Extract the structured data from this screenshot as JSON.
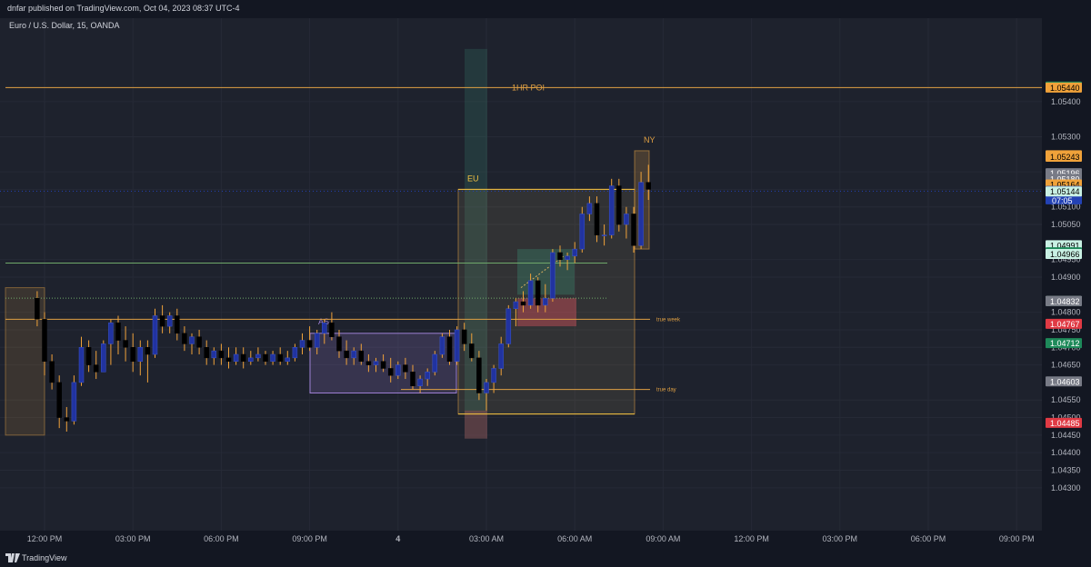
{
  "header": {
    "published": "dnfar published on TradingView.com, Oct 04, 2023 08:37 UTC-4"
  },
  "symbol": "Euro / U.S. Dollar, 15, OANDA",
  "footer": {
    "brand": "TradingView"
  },
  "colors": {
    "background": "#1e222d",
    "grid": "#262a36",
    "bull_body": "#2133a0",
    "bull_wick": "#f0a23a",
    "bear_body": "#000000",
    "orange": "#e0a043",
    "session_as": "#9d7fd3",
    "green_line": "#6fa86a"
  },
  "chart_data": {
    "type": "candlestick",
    "instrument": "EUR/USD",
    "timeframe": "15",
    "ylim": [
      1.0424,
      1.0556
    ],
    "y_ticks": [
      "1.05400",
      "1.05300",
      "1.05200",
      "1.05150",
      "1.05100",
      "1.05050",
      "1.04950",
      "1.04900",
      "1.04800",
      "1.04750",
      "1.04700",
      "1.04650",
      "1.04550",
      "1.04500",
      "1.04450",
      "1.04400",
      "1.04350",
      "1.04300"
    ],
    "x_ticks": [
      "12:00 PM",
      "03:00 PM",
      "06:00 PM",
      "09:00 PM",
      "4",
      "03:00 AM",
      "06:00 AM",
      "09:00 AM",
      "12:00 PM",
      "03:00 PM",
      "06:00 PM",
      "09:00 PM"
    ],
    "bars_per_hour": 4,
    "first_bar_hour": 11.75,
    "candles": [
      [
        1.0484,
        1.0486,
        1.0476,
        1.0478
      ],
      [
        1.0478,
        1.048,
        1.0462,
        1.0466
      ],
      [
        1.0466,
        1.0468,
        1.0458,
        1.046
      ],
      [
        1.046,
        1.0462,
        1.0447,
        1.045
      ],
      [
        1.045,
        1.0453,
        1.0446,
        1.0449
      ],
      [
        1.0449,
        1.0462,
        1.0448,
        1.046
      ],
      [
        1.046,
        1.0473,
        1.0459,
        1.047
      ],
      [
        1.047,
        1.0472,
        1.0463,
        1.0465
      ],
      [
        1.0465,
        1.0469,
        1.0461,
        1.0463
      ],
      [
        1.0463,
        1.0472,
        1.0463,
        1.0471
      ],
      [
        1.0471,
        1.0478,
        1.0465,
        1.0477
      ],
      [
        1.0477,
        1.0479,
        1.0468,
        1.0472
      ],
      [
        1.0472,
        1.0476,
        1.0466,
        1.047
      ],
      [
        1.047,
        1.0474,
        1.0463,
        1.0466
      ],
      [
        1.0466,
        1.0472,
        1.0462,
        1.047
      ],
      [
        1.047,
        1.0472,
        1.046,
        1.0468
      ],
      [
        1.0468,
        1.0481,
        1.0467,
        1.0479
      ],
      [
        1.0479,
        1.0482,
        1.0474,
        1.0476
      ],
      [
        1.0476,
        1.048,
        1.0474,
        1.0479
      ],
      [
        1.0479,
        1.0481,
        1.0472,
        1.0474
      ],
      [
        1.0474,
        1.0476,
        1.0469,
        1.0471
      ],
      [
        1.0471,
        1.0474,
        1.0468,
        1.0473
      ],
      [
        1.0473,
        1.0475,
        1.0468,
        1.047
      ],
      [
        1.047,
        1.0472,
        1.0465,
        1.0467
      ],
      [
        1.0467,
        1.047,
        1.0465,
        1.0469
      ],
      [
        1.0469,
        1.0471,
        1.0465,
        1.0467
      ],
      [
        1.0467,
        1.047,
        1.0464,
        1.0466
      ],
      [
        1.0466,
        1.047,
        1.0465,
        1.0468
      ],
      [
        1.0468,
        1.047,
        1.0464,
        1.0466
      ],
      [
        1.0466,
        1.0469,
        1.0465,
        1.0467
      ],
      [
        1.0467,
        1.047,
        1.0466,
        1.0468
      ],
      [
        1.0468,
        1.0469,
        1.0465,
        1.0466
      ],
      [
        1.0466,
        1.0469,
        1.0465,
        1.0468
      ],
      [
        1.0468,
        1.047,
        1.0465,
        1.0466
      ],
      [
        1.0466,
        1.0469,
        1.0465,
        1.0467
      ],
      [
        1.0467,
        1.0471,
        1.0466,
        1.047
      ],
      [
        1.047,
        1.0474,
        1.0468,
        1.0472
      ],
      [
        1.0472,
        1.0476,
        1.0469,
        1.047
      ],
      [
        1.047,
        1.0475,
        1.0468,
        1.0474
      ],
      [
        1.0474,
        1.0478,
        1.0471,
        1.0477
      ],
      [
        1.0477,
        1.048,
        1.0472,
        1.0473
      ],
      [
        1.0473,
        1.0475,
        1.0467,
        1.0469
      ],
      [
        1.0469,
        1.0472,
        1.0465,
        1.0467
      ],
      [
        1.0467,
        1.047,
        1.0465,
        1.0469
      ],
      [
        1.0469,
        1.0471,
        1.0465,
        1.0466
      ],
      [
        1.0466,
        1.0468,
        1.0463,
        1.0465
      ],
      [
        1.0465,
        1.0467,
        1.0463,
        1.0466
      ],
      [
        1.0466,
        1.0468,
        1.0463,
        1.0464
      ],
      [
        1.0464,
        1.0467,
        1.046,
        1.0462
      ],
      [
        1.0462,
        1.0466,
        1.0461,
        1.0465
      ],
      [
        1.0465,
        1.0467,
        1.0461,
        1.0463
      ],
      [
        1.0463,
        1.0465,
        1.0458,
        1.0459
      ],
      [
        1.0459,
        1.0462,
        1.0457,
        1.0461
      ],
      [
        1.0461,
        1.0464,
        1.0459,
        1.0463
      ],
      [
        1.0463,
        1.0469,
        1.0462,
        1.0468
      ],
      [
        1.0468,
        1.0474,
        1.0467,
        1.0473
      ],
      [
        1.0473,
        1.0475,
        1.0465,
        1.0466
      ],
      [
        1.0466,
        1.0476,
        1.0465,
        1.0475
      ],
      [
        1.0475,
        1.0477,
        1.0469,
        1.0471
      ],
      [
        1.0471,
        1.0474,
        1.0466,
        1.0467
      ],
      [
        1.0467,
        1.0469,
        1.0455,
        1.0457
      ],
      [
        1.0457,
        1.0461,
        1.0452,
        1.046
      ],
      [
        1.046,
        1.0465,
        1.0457,
        1.0464
      ],
      [
        1.0464,
        1.0473,
        1.0462,
        1.0471
      ],
      [
        1.0471,
        1.0482,
        1.047,
        1.0481
      ],
      [
        1.0481,
        1.0484,
        1.0476,
        1.0483
      ],
      [
        1.0483,
        1.0486,
        1.048,
        1.0482
      ],
      [
        1.0482,
        1.0491,
        1.0481,
        1.0489
      ],
      [
        1.0489,
        1.049,
        1.048,
        1.0482
      ],
      [
        1.0482,
        1.0488,
        1.048,
        1.0484
      ],
      [
        1.0484,
        1.0498,
        1.0483,
        1.0497
      ],
      [
        1.0497,
        1.0499,
        1.0493,
        1.0495
      ],
      [
        1.0495,
        1.0497,
        1.0492,
        1.0496
      ],
      [
        1.0496,
        1.05,
        1.0494,
        1.0498
      ],
      [
        1.0498,
        1.051,
        1.0497,
        1.0508
      ],
      [
        1.0508,
        1.0513,
        1.0506,
        1.0511
      ],
      [
        1.0511,
        1.0513,
        1.05,
        1.0502
      ],
      [
        1.0502,
        1.0505,
        1.0499,
        1.0502
      ],
      [
        1.0502,
        1.0518,
        1.0501,
        1.0516
      ],
      [
        1.0516,
        1.0518,
        1.0503,
        1.0505
      ],
      [
        1.0505,
        1.051,
        1.0501,
        1.0508
      ],
      [
        1.0508,
        1.051,
        1.0497,
        1.0499
      ],
      [
        1.0499,
        1.052,
        1.0498,
        1.0517
      ],
      [
        1.0517,
        1.0522,
        1.0512,
        1.0515
      ]
    ],
    "lines": [
      {
        "label": "1HR POI",
        "price": 1.0544
      },
      {
        "label": "true week",
        "price": 1.0478
      },
      {
        "label": "true day",
        "price": 1.0458
      },
      {
        "label": "",
        "price": 1.0494
      }
    ],
    "session_boxes": [
      {
        "label": "AS",
        "top": 1.0474,
        "bottom": 1.0457
      },
      {
        "label": "EU",
        "top": 1.0515,
        "bottom": 1.0451
      },
      {
        "label": "NY",
        "top": 1.0526,
        "bottom": 1.0498
      }
    ],
    "price_labels": [
      {
        "price": 1.05443,
        "text": "1.05443",
        "bg": "#1e8a5a",
        "fg": "#ffffff"
      },
      {
        "price": 1.0544,
        "text": "1.05440",
        "bg": "#f0a23a",
        "fg": "#000000"
      },
      {
        "price": 1.05247,
        "text": "1.05247",
        "bg": "#f0a23a",
        "fg": "#000000"
      },
      {
        "price": 1.05243,
        "text": "1.05243",
        "bg": "#f0a23a",
        "fg": "#000000"
      },
      {
        "price": 1.05196,
        "text": "1.05196",
        "bg": "#787b86",
        "fg": "#ffffff"
      },
      {
        "price": 1.0518,
        "text": "1.05180",
        "bg": "#787b86",
        "fg": "#ffffff"
      },
      {
        "price": 1.05164,
        "text": "1.05164",
        "bg": "#f0a23a",
        "fg": "#000000"
      },
      {
        "price": 1.05146,
        "text": "1.05146",
        "bg": "#787b86",
        "fg": "#ffffff"
      },
      {
        "price": 1.05145,
        "text": "1.05145",
        "bg": "#2342b5",
        "fg": "#ffffff",
        "sub": "07:05"
      },
      {
        "price": 1.05144,
        "text": "1.05144",
        "bg": "#c9f1e4",
        "fg": "#000000"
      },
      {
        "price": 1.04991,
        "text": "1.04991",
        "bg": "#c9f1e4",
        "fg": "#000000"
      },
      {
        "price": 1.04971,
        "text": "1.04971",
        "bg": "#1e8a5a",
        "fg": "#ffffff"
      },
      {
        "price": 1.04966,
        "text": "1.04966",
        "bg": "#c9f1e4",
        "fg": "#000000"
      },
      {
        "price": 1.04832,
        "text": "1.04832",
        "bg": "#c9f1e4",
        "fg": "#000000"
      },
      {
        "price": 1.04832,
        "text": "1.04832",
        "bg": "#787b86",
        "fg": "#ffffff"
      },
      {
        "price": 1.04767,
        "text": "1.04767",
        "bg": "#e03a44",
        "fg": "#ffffff"
      },
      {
        "price": 1.04712,
        "text": "1.04712",
        "bg": "#1e8a5a",
        "fg": "#ffffff"
      },
      {
        "price": 1.04603,
        "text": "1.04603",
        "bg": "#787b86",
        "fg": "#ffffff"
      },
      {
        "price": 1.04485,
        "text": "1.04485",
        "bg": "#e03a44",
        "fg": "#ffffff"
      }
    ]
  }
}
